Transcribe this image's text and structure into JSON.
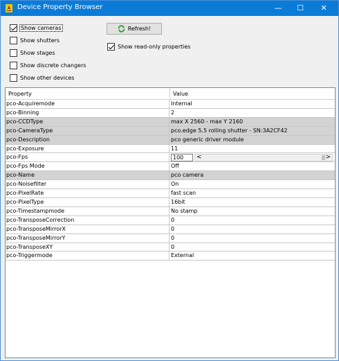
{
  "window": {
    "title": "Device Property Browser",
    "controls": {
      "minimize": "—",
      "maximize": "☐",
      "close": "✕"
    }
  },
  "filters": [
    {
      "label": "Show cameras",
      "checked": true
    },
    {
      "label": "Show shutters",
      "checked": false
    },
    {
      "label": "Show stages",
      "checked": false
    },
    {
      "label": "Show discrete changers",
      "checked": false
    },
    {
      "label": "Show other devices",
      "checked": false
    }
  ],
  "refresh_button": {
    "label": "Refresh!"
  },
  "readonly_toggle": {
    "label": "Show read-only properties",
    "checked": true
  },
  "grid": {
    "columns": [
      "Property",
      "Value"
    ],
    "rows": [
      {
        "property": "pco-Acquiremode",
        "value": "Internal",
        "readonly": false
      },
      {
        "property": "pco-Binning",
        "value": "2",
        "readonly": false
      },
      {
        "property": "pco-CCDType",
        "value": "max X 2560 - max Y 2160",
        "readonly": true
      },
      {
        "property": "pco-CameraType",
        "value": "pco.edge 5.5 rolling shutter - SN:3A2CF42",
        "readonly": true
      },
      {
        "property": "pco-Description",
        "value": "pco generic driver module",
        "readonly": true
      },
      {
        "property": "pco-Exposure",
        "value": "11",
        "readonly": false
      },
      {
        "property": "pco-Fps",
        "value": "100",
        "readonly": false,
        "slider": {
          "left": "<",
          "right": ">"
        }
      },
      {
        "property": "pco-Fps Mode",
        "value": "Off",
        "readonly": false
      },
      {
        "property": "pco-Name",
        "value": "pco camera",
        "readonly": true
      },
      {
        "property": "pco-Noisefilter",
        "value": "On",
        "readonly": false
      },
      {
        "property": "pco-PixelRate",
        "value": "fast scan",
        "readonly": false
      },
      {
        "property": "pco-PixelType",
        "value": "16bit",
        "readonly": false
      },
      {
        "property": "pco-Timestampmode",
        "value": "No stamp",
        "readonly": false
      },
      {
        "property": "pco-TransposeCorrection",
        "value": "0",
        "readonly": false
      },
      {
        "property": "pco-TransposeMirrorX",
        "value": "0",
        "readonly": false
      },
      {
        "property": "pco-TransposeMirrorY",
        "value": "0",
        "readonly": false
      },
      {
        "property": "pco-TransposeXY",
        "value": "0",
        "readonly": false
      },
      {
        "property": "pco-Triggermode",
        "value": "External",
        "readonly": false
      }
    ]
  },
  "colors": {
    "titlebar": "#0b7bd8",
    "readonly_row": "#d3d3d3"
  }
}
